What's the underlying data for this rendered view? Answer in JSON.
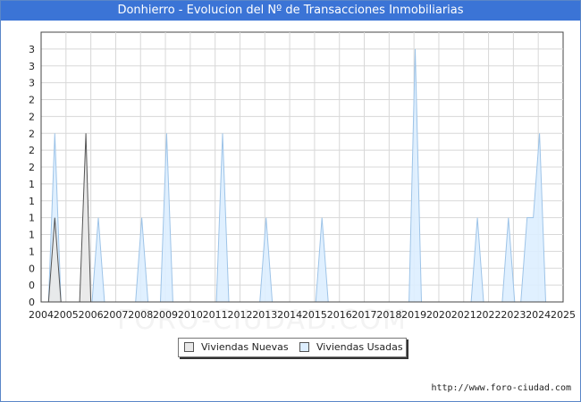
{
  "title": "Donhierro - Evolucion del Nº de Transacciones Inmobiliarias",
  "footer_url": "http://www.foro-ciudad.com",
  "watermark": "FORO-CIUDAD.COM",
  "colors": {
    "title_bg": "#3b74d6",
    "nuevas_fill": "#e8e8e8",
    "nuevas_stroke": "#555555",
    "usadas_fill": "#ddeeff",
    "usadas_stroke": "#9ec4e8",
    "grid": "#d8d8d8"
  },
  "chart_data": {
    "type": "area",
    "x_tick_labels": [
      "2004",
      "2005",
      "2006",
      "2007",
      "2008",
      "2009",
      "2010",
      "2011",
      "2012",
      "2013",
      "2014",
      "2015",
      "2016",
      "2017",
      "2018",
      "2019",
      "2020",
      "2021",
      "2022",
      "2023",
      "2024",
      "2025"
    ],
    "y_tick_labels": [
      "0",
      "0",
      "0",
      "1",
      "1",
      "1",
      "1",
      "1",
      "2",
      "2",
      "2",
      "2",
      "2",
      "3",
      "3",
      "3"
    ],
    "ylim": [
      0,
      3.2
    ],
    "xlim": [
      2004,
      2025
    ],
    "grid": true,
    "legend_placement": "bottom-center",
    "series": [
      {
        "name": "Viviendas Nuevas",
        "points": [
          [
            2004.3,
            0
          ],
          [
            2004.55,
            1
          ],
          [
            2004.8,
            0
          ],
          [
            2005.55,
            0
          ],
          [
            2005.8,
            2
          ],
          [
            2006.0,
            0
          ]
        ]
      },
      {
        "name": "Viviendas Usadas",
        "points": [
          [
            2004.3,
            0
          ],
          [
            2004.55,
            2
          ],
          [
            2004.8,
            0
          ],
          [
            2006.05,
            0
          ],
          [
            2006.3,
            1
          ],
          [
            2006.55,
            0
          ],
          [
            2007.8,
            0
          ],
          [
            2008.05,
            1
          ],
          [
            2008.3,
            0
          ],
          [
            2008.8,
            0
          ],
          [
            2009.05,
            2
          ],
          [
            2009.3,
            0
          ],
          [
            2011.05,
            0
          ],
          [
            2011.3,
            2
          ],
          [
            2011.55,
            0
          ],
          [
            2012.8,
            0
          ],
          [
            2013.05,
            1
          ],
          [
            2013.3,
            0
          ],
          [
            2015.05,
            0
          ],
          [
            2015.3,
            1
          ],
          [
            2015.55,
            0
          ],
          [
            2018.8,
            0
          ],
          [
            2019.05,
            3
          ],
          [
            2019.3,
            0
          ],
          [
            2021.3,
            0
          ],
          [
            2021.55,
            1
          ],
          [
            2021.8,
            0
          ],
          [
            2022.55,
            0
          ],
          [
            2022.8,
            1
          ],
          [
            2023.05,
            0
          ],
          [
            2023.3,
            0
          ],
          [
            2023.55,
            1
          ],
          [
            2023.8,
            1
          ],
          [
            2024.05,
            2
          ],
          [
            2024.3,
            0
          ]
        ]
      }
    ]
  }
}
